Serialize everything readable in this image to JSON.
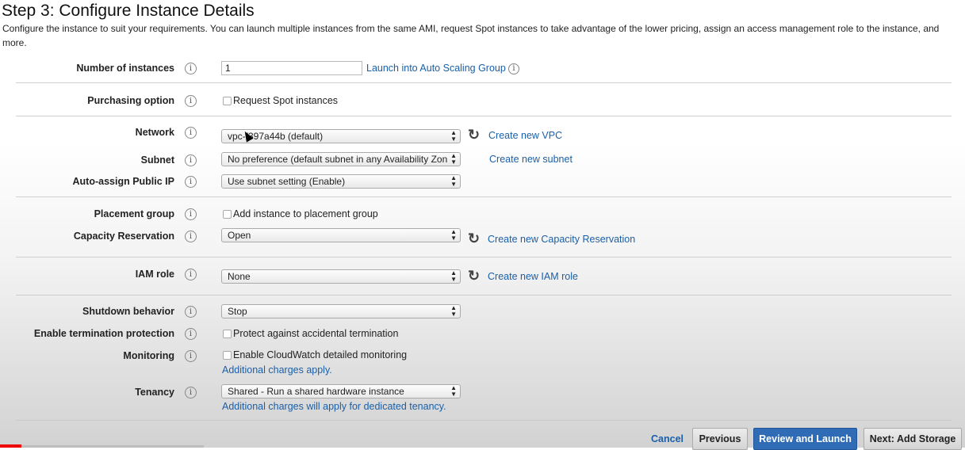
{
  "header": {
    "title": "Step 3: Configure Instance Details",
    "description": "Configure the instance to suit your requirements. You can launch multiple instances from the same AMI, request Spot instances to take advantage of the lower pricing, assign an access management role to the instance, and more."
  },
  "info_glyph": "i",
  "arrows": {
    "up": "▲",
    "down": "▼"
  },
  "refresh_glyph": "↻",
  "fields": {
    "number_of_instances": {
      "label": "Number of instances",
      "value": "1",
      "link": "Launch into Auto Scaling Group"
    },
    "purchasing_option": {
      "label": "Purchasing option",
      "checkbox_label": "Request Spot instances"
    },
    "network": {
      "label": "Network",
      "value": "vpc-f397a44b (default)",
      "link": "Create new VPC"
    },
    "subnet": {
      "label": "Subnet",
      "value": "No preference (default subnet in any Availability Zon",
      "link": "Create new subnet"
    },
    "auto_assign_ip": {
      "label": "Auto-assign Public IP",
      "value": "Use subnet setting (Enable)"
    },
    "placement_group": {
      "label": "Placement group",
      "checkbox_label": "Add instance to placement group"
    },
    "capacity_reservation": {
      "label": "Capacity Reservation",
      "value": "Open",
      "link": "Create new Capacity Reservation"
    },
    "iam_role": {
      "label": "IAM role",
      "value": "None",
      "link": "Create new IAM role"
    },
    "shutdown_behavior": {
      "label": "Shutdown behavior",
      "value": "Stop"
    },
    "termination_protection": {
      "label": "Enable termination protection",
      "checkbox_label": "Protect against accidental termination"
    },
    "monitoring": {
      "label": "Monitoring",
      "checkbox_label": "Enable CloudWatch detailed monitoring",
      "note": "Additional charges apply."
    },
    "tenancy": {
      "label": "Tenancy",
      "value": "Shared - Run a shared hardware instance",
      "note": "Additional charges will apply for dedicated tenancy."
    }
  },
  "footer": {
    "cancel": "Cancel",
    "previous": "Previous",
    "review_launch": "Review and Launch",
    "next": "Next: Add Storage"
  },
  "colors": {
    "link": "#1a5fa8",
    "primary_button": "#2f6cb5",
    "progress": "#e00000"
  }
}
